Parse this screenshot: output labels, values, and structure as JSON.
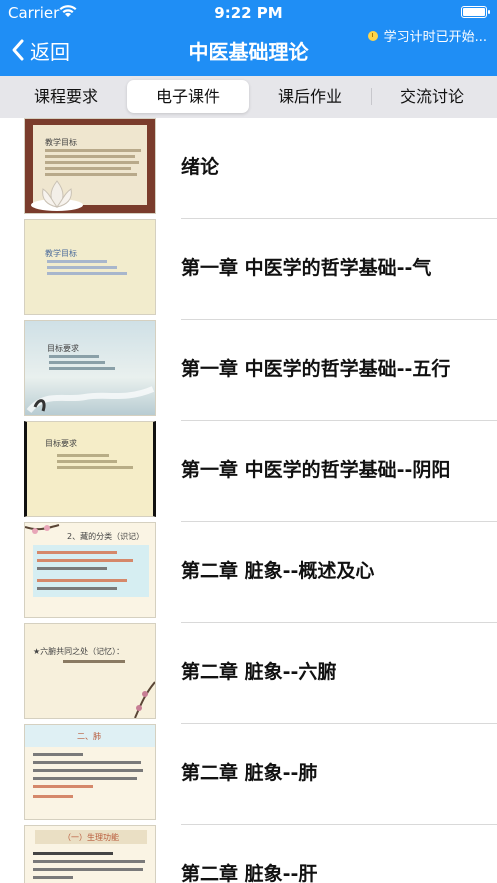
{
  "status_bar": {
    "carrier": "Carrier",
    "time": "9:22 PM"
  },
  "nav": {
    "back_label": "返回",
    "title": "中医基础理论",
    "timer_text": "学习计时已开始..."
  },
  "tabs": [
    {
      "label": "课程要求",
      "active": false
    },
    {
      "label": "电子课件",
      "active": true
    },
    {
      "label": "课后作业",
      "active": false
    },
    {
      "label": "交流讨论",
      "active": false
    }
  ],
  "lessons": [
    {
      "title": "绪论",
      "slide_heading": "教学目标"
    },
    {
      "title": "第一章 中医学的哲学基础--气",
      "slide_heading": "教学目标"
    },
    {
      "title": "第一章 中医学的哲学基础--五行",
      "slide_heading": "目标要求"
    },
    {
      "title": "第一章 中医学的哲学基础--阴阳",
      "slide_heading": "目标要求"
    },
    {
      "title": "第二章 脏象--概述及心",
      "slide_heading": "2、藏的分类（识记）"
    },
    {
      "title": "第二章 脏象--六腑",
      "slide_heading": "★六腑共同之处（记忆）："
    },
    {
      "title": "第二章 脏象--肺",
      "slide_heading": "二、肺"
    },
    {
      "title": "第二章 脏象--肝",
      "slide_heading": "（一）生理功能"
    }
  ]
}
